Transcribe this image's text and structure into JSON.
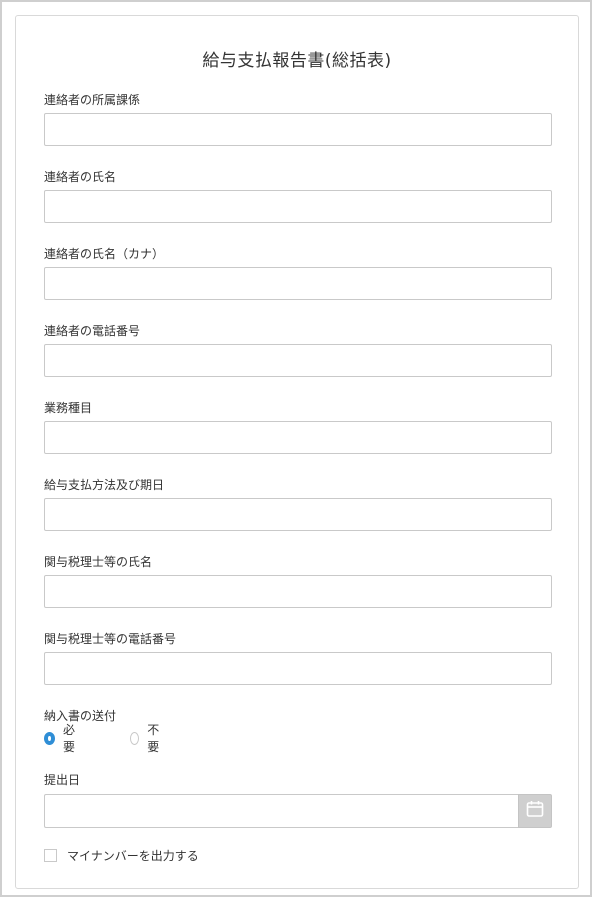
{
  "form": {
    "title": "給与支払報告書(総括表)",
    "fields": [
      {
        "label": "連絡者の所属課係",
        "value": "",
        "placeholder": ""
      },
      {
        "label": "連絡者の氏名",
        "value": "",
        "placeholder": ""
      },
      {
        "label": "連絡者の氏名（カナ）",
        "value": "",
        "placeholder": ""
      },
      {
        "label": "連絡者の電話番号",
        "value": "",
        "placeholder": ""
      },
      {
        "label": "業務種目",
        "value": "",
        "placeholder": ""
      },
      {
        "label": "給与支払方法及び期日",
        "value": "",
        "placeholder": ""
      },
      {
        "label": "関与税理士等の氏名",
        "value": "",
        "placeholder": ""
      },
      {
        "label": "関与税理士等の電話番号",
        "value": "",
        "placeholder": ""
      }
    ],
    "delivery": {
      "label": "納入書の送付",
      "options": [
        "必要",
        "不要"
      ],
      "selected": "必要"
    },
    "submit_date": {
      "label": "提出日",
      "value": "",
      "icon": "calendar-icon"
    },
    "my_number_checkbox": {
      "label": "マイナンバーを出力する",
      "checked": false
    }
  },
  "colors": {
    "accent": "#2f8ed6",
    "border": "#c9c9c9",
    "text": "#333333",
    "date_button_bg": "#cfcfcf"
  }
}
